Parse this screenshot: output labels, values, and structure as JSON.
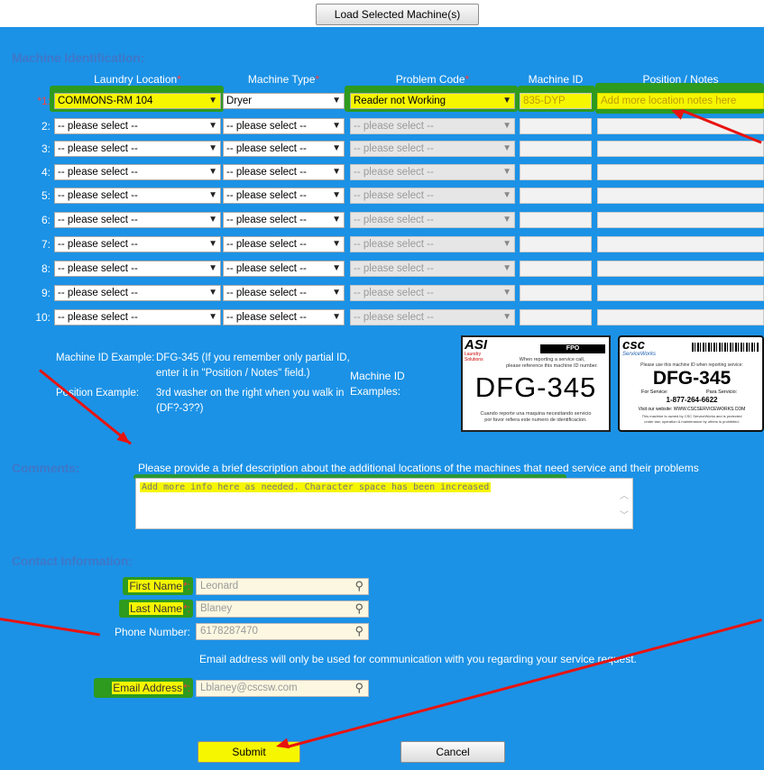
{
  "top": {
    "load_button": "Load Selected Machine(s)"
  },
  "sections": {
    "machine_identification": "Machine Identification:",
    "comments": "Comments:",
    "contact_information": "Contact Information:"
  },
  "columns": {
    "laundry_location": "Laundry Location",
    "machine_type": "Machine Type",
    "problem_code": "Problem Code",
    "machine_id": "Machine ID",
    "position_notes": "Position / Notes",
    "required_mark": "*"
  },
  "rows": [
    {
      "num": "*1:",
      "location": "COMMONS-RM 104",
      "type": "Dryer",
      "problem": "Reader not Working",
      "machine_id": "835-DYP",
      "notes": "Add more location notes here"
    },
    {
      "num": "2:",
      "location": "-- please select --",
      "type": "-- please select --",
      "problem": "-- please select --",
      "machine_id": "",
      "notes": ""
    },
    {
      "num": "3:",
      "location": "-- please select --",
      "type": "-- please select --",
      "problem": "-- please select --",
      "machine_id": "",
      "notes": ""
    },
    {
      "num": "4:",
      "location": "-- please select --",
      "type": "-- please select --",
      "problem": "-- please select --",
      "machine_id": "",
      "notes": ""
    },
    {
      "num": "5:",
      "location": "-- please select --",
      "type": "-- please select --",
      "problem": "-- please select --",
      "machine_id": "",
      "notes": ""
    },
    {
      "num": "6:",
      "location": "-- please select --",
      "type": "-- please select --",
      "problem": "-- please select --",
      "machine_id": "",
      "notes": ""
    },
    {
      "num": "7:",
      "location": "-- please select --",
      "type": "-- please select --",
      "problem": "-- please select --",
      "machine_id": "",
      "notes": ""
    },
    {
      "num": "8:",
      "location": "-- please select --",
      "type": "-- please select --",
      "problem": "-- please select --",
      "machine_id": "",
      "notes": ""
    },
    {
      "num": "9:",
      "location": "-- please select --",
      "type": "-- please select --",
      "problem": "-- please select --",
      "machine_id": "",
      "notes": ""
    },
    {
      "num": "10:",
      "location": "-- please select --",
      "type": "-- please select --",
      "problem": "-- please select --",
      "machine_id": "",
      "notes": ""
    }
  ],
  "examples": {
    "machine_id_label": "Machine ID Example:",
    "machine_id_text_1": "DFG-345 (If you remember only partial ID,",
    "machine_id_text_2": "enter it in \"Position / Notes\" field.)",
    "position_label": "Position Example:",
    "position_text_1": "3rd washer on the right when you walk in",
    "position_text_2": "(DF?-3??)",
    "machine_id_examples_1": "Machine ID",
    "machine_id_examples_2": "Examples:"
  },
  "label_asi": {
    "logo": "ASI",
    "logo_sub": "Laundry Solutions",
    "fpo": "FPO",
    "line1": "When reporting a service call,",
    "line2": "please reference this machine ID number.",
    "id": "DFG-345",
    "spanish1": "Cuando reporte una maquina necesitando servicio",
    "spanish2": "por favor refiera este numero de identificacion."
  },
  "label_csc": {
    "logo": "csc",
    "logo_sub": "ServiceWorks",
    "line1": "Please use this machine ID when reporting service:",
    "id": "DFG-345",
    "for_service": "For Service:",
    "para_servicio": "Para Servicio:",
    "phone": "1-877-264-6622",
    "website": "Visit our website: WWW.CSCSERVICEWORKS.COM",
    "fine1": "This machine is owned by CSC ServiceWorks and is protected",
    "fine2": "under law; operation & maintenance by others is prohibited."
  },
  "comments": {
    "prompt": "Please provide a brief description about the additional locations of the machines that need service and their problems",
    "value": "Add more info here as needed. Character space has been increased"
  },
  "contact": {
    "first_name_label": "First Name",
    "first_name_value": "Leonard",
    "last_name_label": "Last Name",
    "last_name_value": "Blaney",
    "phone_label": "Phone Number:",
    "phone_value": "6178287470",
    "email_note": "Email address will only be used for communication with you regarding your service request.",
    "email_label": "Email Address",
    "email_value": "Lblaney@cscsw.com",
    "required_mark": "*:"
  },
  "buttons": {
    "submit": "Submit",
    "cancel": "Cancel"
  },
  "colors": {
    "background": "#1b92e6",
    "highlight_yellow": "#f6f600",
    "highlight_green": "#2e9a1e",
    "arrow_red": "#e8130f",
    "section_title": "#3f77c8"
  }
}
